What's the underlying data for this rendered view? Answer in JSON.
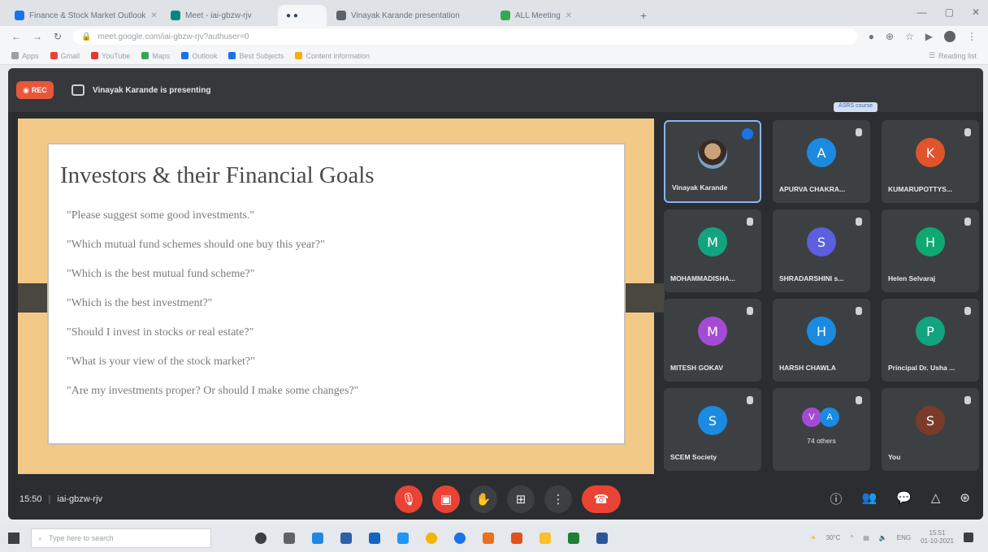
{
  "browser": {
    "tabs": [
      {
        "label": "Finance & Stock Market Outlook",
        "active": false,
        "color": "#1a73e8"
      },
      {
        "label": "Meet - iai-gbzw-rjv",
        "active": false,
        "color": "#00897b"
      },
      {
        "label": "",
        "active": true,
        "color": ""
      },
      {
        "label": "Vinayak Karande presentation",
        "active": false,
        "color": "#5f6368"
      },
      {
        "label": "ALL Meeting",
        "active": false,
        "color": "#34a853"
      }
    ],
    "new_tab": "+",
    "url": "meet.google.com/iai-gbzw-rjv?authuser=0",
    "bookmarks": [
      "Apps",
      "Gmail",
      "YouTube",
      "Maps",
      "Outlook",
      "Best Subjects",
      "Content information"
    ],
    "reading_list": "Reading list"
  },
  "meet": {
    "rec_label": "REC",
    "presenting": "Vinayak Karande is presenting",
    "slide": {
      "title": "Investors & their Financial Goals",
      "quotes": [
        "\"Please suggest some good investments.\"",
        "\"Which mutual fund schemes should one buy this year?\"",
        "\"Which is the best mutual fund scheme?\"",
        "\"Which is the best investment?\"",
        "\"Should I invest in stocks or real estate?\"",
        "\"What is your view of the stock market?\"",
        "\"Are my investments proper? Or should I make some changes?\""
      ]
    },
    "participants": [
      {
        "name": "Vinayak Karande",
        "initial": "",
        "color": "",
        "talking": true
      },
      {
        "name": "APURVA CHAKRA...",
        "initial": "A",
        "color": "#1a8be0",
        "talking": false
      },
      {
        "name": "KUMARUPOTTYS...",
        "initial": "K",
        "color": "#e0542c",
        "talking": false
      },
      {
        "name": "MOHAMMADISHA...",
        "initial": "M",
        "color": "#12a37f",
        "talking": false
      },
      {
        "name": "SHRADARSHINI s...",
        "initial": "S",
        "color": "#5b5fe0",
        "talking": false
      },
      {
        "name": "Helen Selvaraj",
        "initial": "H",
        "color": "#0fa871",
        "talking": false
      },
      {
        "name": "MITESH GOKAV",
        "initial": "M",
        "color": "#a44bd6",
        "talking": false
      },
      {
        "name": "HARSH CHAWLA",
        "initial": "H",
        "color": "#1a8be0",
        "talking": false
      },
      {
        "name": "Principal Dr. Usha ...",
        "initial": "P",
        "color": "#12a37f",
        "talking": false
      },
      {
        "name": "SCEM Society",
        "initial": "S",
        "color": "#1a8be0",
        "talking": false
      },
      {
        "name": "74 others",
        "initial": "",
        "color": "",
        "talking": false
      },
      {
        "name": "You",
        "initial": "S",
        "color": "#7a3b2a",
        "talking": false
      }
    ],
    "others_avatars": [
      {
        "initial": "V",
        "color": "#a44bd6"
      },
      {
        "initial": "A",
        "color": "#1a8be0"
      }
    ],
    "meeting_time": "15:50",
    "meeting_code": "iai-gbzw-rjv",
    "notice": "ASRS course"
  },
  "taskbar": {
    "search_placeholder": "Type here to search",
    "weather": "30°C",
    "language": "ENG",
    "time": "15:51",
    "date": "01-10-2021"
  }
}
